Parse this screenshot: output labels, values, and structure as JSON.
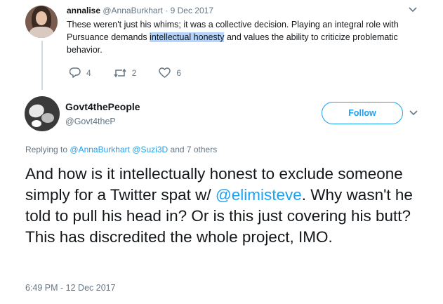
{
  "reply_tweet": {
    "name": "annalise",
    "handle": "@AnnaBurkhart",
    "separator": "·",
    "date": "9 Dec 2017",
    "text_before": "These weren't just his whims; it was a collective decision. Playing an integral role with Pursuance demands ",
    "text_highlight": "intellectual honesty",
    "text_after": " and values the ability to criticize problematic behavior.",
    "actions": {
      "replies": "4",
      "retweets": "2",
      "likes": "6"
    }
  },
  "main_tweet": {
    "name": "Govt4thePeople",
    "handle": "@Govt4theP",
    "follow_label": "Follow",
    "replying_prefix": "Replying to",
    "replying_user1": "@AnnaBurkhart",
    "replying_user2": "@Suzi3D",
    "replying_suffix": "and 7 others",
    "text_part1": "And how is it intellectually honest to exclude someone simply for a Twitter spat w/ ",
    "mention": "@elimisteve",
    "text_part2": ". Why wasn't he told to pull his head in?  Or is this just covering his butt? This has discredited the whole project, IMO.",
    "timestamp": "6:49 PM - 12 Dec 2017"
  },
  "colors": {
    "accent": "#1da1f2",
    "muted": "#657786",
    "text": "#14171a",
    "highlight": "#b3d4fd"
  },
  "icons": [
    "reply-icon",
    "retweet-icon",
    "like-icon",
    "chevron-down-icon"
  ]
}
